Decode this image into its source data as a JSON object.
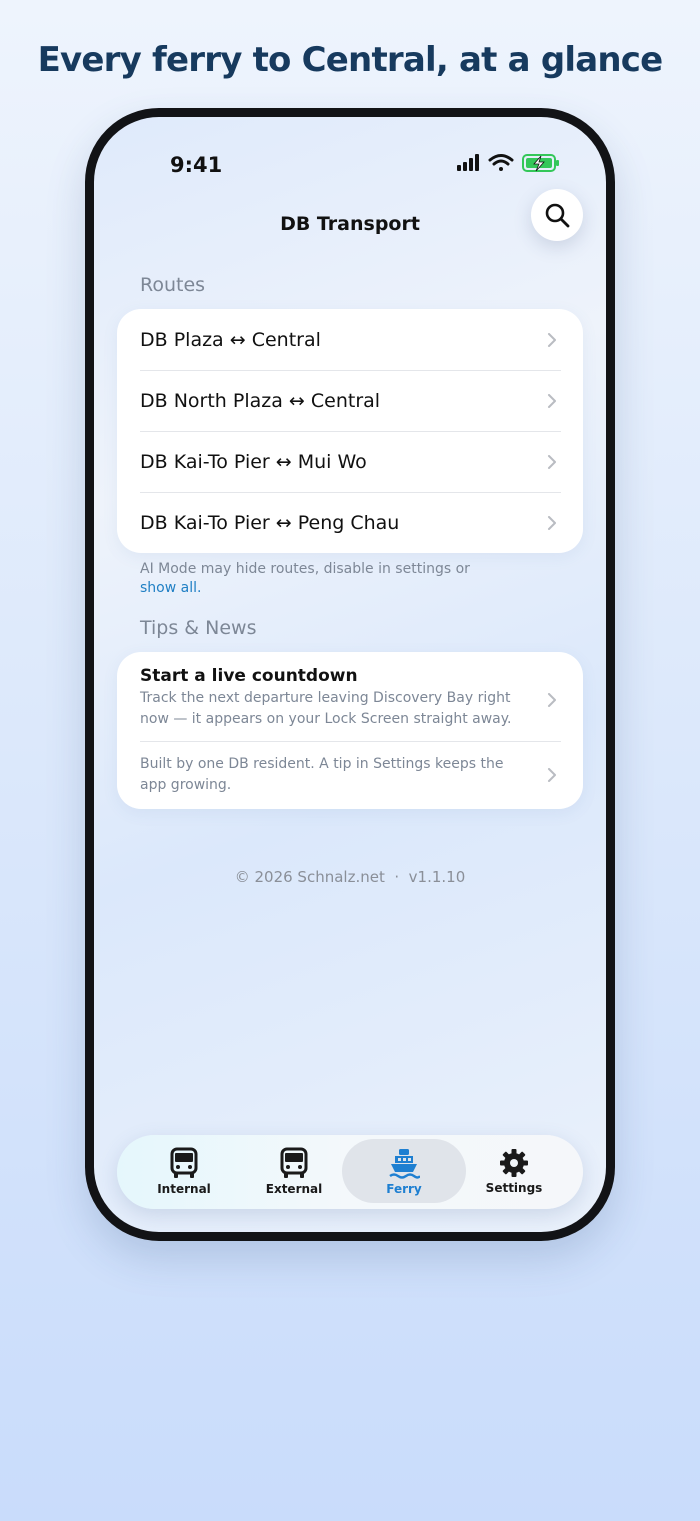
{
  "headline": "Every ferry to Central, at a glance",
  "status_bar": {
    "time": "9:41",
    "icons": [
      "cellular-signal-icon",
      "wifi-icon",
      "battery-charging-icon"
    ]
  },
  "header": {
    "title": "DB Transport",
    "search_icon": "search-icon"
  },
  "routes": {
    "section_label": "Routes",
    "items": [
      {
        "label": "DB Plaza ↔ Central"
      },
      {
        "label": "DB North Plaza ↔ Central"
      },
      {
        "label": "DB Kai-To Pier ↔ Mui Wo"
      },
      {
        "label": "DB Kai-To Pier ↔ Peng Chau"
      }
    ],
    "footnote": "AI Mode may hide routes, disable in settings or",
    "footnote_link": "show all."
  },
  "tips": {
    "section_label": "Tips & News",
    "items": [
      {
        "title": "Start a live countdown",
        "body": "Track the next departure leaving Discovery Bay right now — it appears on your Lock Screen straight away."
      },
      {
        "body": "Built by one DB resident. A tip in Settings keeps the app growing."
      }
    ]
  },
  "footer": {
    "copyright": "© 2026 Schnalz.net  ·  v1.1.10"
  },
  "tabbar": {
    "tabs": [
      {
        "label": "Internal",
        "icon": "bus-icon",
        "active": false
      },
      {
        "label": "External",
        "icon": "bus-icon",
        "active": false
      },
      {
        "label": "Ferry",
        "icon": "ferry-icon",
        "active": true
      },
      {
        "label": "Settings",
        "icon": "gear-icon",
        "active": false
      }
    ]
  },
  "colors": {
    "accent": "#1e7fd1",
    "link": "#1f7fc4",
    "headline": "#173a5e",
    "battery": "#34c759"
  }
}
